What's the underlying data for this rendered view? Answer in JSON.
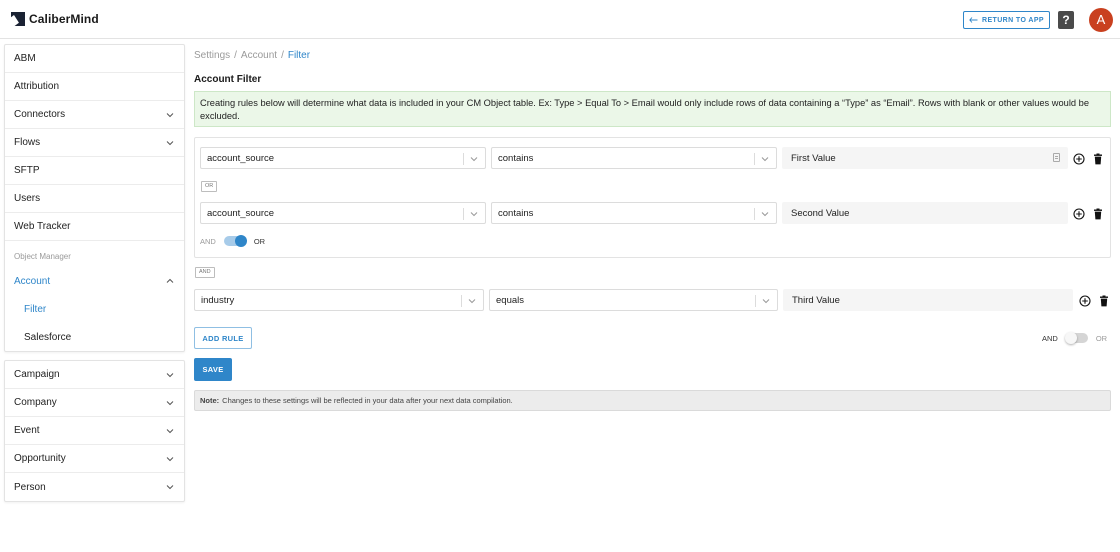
{
  "header": {
    "brand": "CaliberMind",
    "return_label": "RETURN TO APP",
    "help_label": "?",
    "avatar_initial": "A",
    "accent_color": "#2f86c9",
    "avatar_color": "#c9401f"
  },
  "sidebar": {
    "top_items": [
      {
        "label": "ABM",
        "has_chevron": false
      },
      {
        "label": "Attribution",
        "has_chevron": false
      },
      {
        "label": "Connectors",
        "has_chevron": true
      },
      {
        "label": "Flows",
        "has_chevron": true
      },
      {
        "label": "SFTP",
        "has_chevron": false
      },
      {
        "label": "Users",
        "has_chevron": false
      },
      {
        "label": "Web Tracker",
        "has_chevron": false
      }
    ],
    "section_label": "Object Manager",
    "expanded_item": {
      "label": "Account",
      "sub_items": [
        "Filter",
        "Salesforce"
      ],
      "active_sub": "Filter"
    },
    "bottom_items": [
      {
        "label": "Campaign"
      },
      {
        "label": "Company"
      },
      {
        "label": "Event"
      },
      {
        "label": "Opportunity"
      },
      {
        "label": "Person"
      }
    ]
  },
  "breadcrumb": {
    "items": [
      "Settings",
      "Account",
      "Filter"
    ],
    "separator": "/"
  },
  "page": {
    "title": "Account Filter",
    "info_text": "Creating rules below will determine what data is included in your CM Object table. Ex: Type > Equal To > Email would only include rows of data containing a “Type” as “Email”. Rows with blank or other values would be excluded."
  },
  "group": {
    "rules": [
      {
        "field": "account_source",
        "operator": "contains",
        "value": "First Value"
      },
      {
        "field": "account_source",
        "operator": "contains",
        "value": "Second Value"
      }
    ],
    "between_tag": "OR",
    "toggle": {
      "left": "AND",
      "right": "OR",
      "selected": "OR"
    }
  },
  "outer_tag": "AND",
  "standalone_rule": {
    "field": "industry",
    "operator": "equals",
    "value": "Third Value"
  },
  "actions": {
    "add_rule_label": "ADD RULE",
    "save_label": "SAVE",
    "toggle": {
      "left": "AND",
      "right": "OR",
      "selected": "AND"
    }
  },
  "note": {
    "label": "Note:",
    "text": "Changes to these settings will be reflected in your data after your next data compilation."
  }
}
